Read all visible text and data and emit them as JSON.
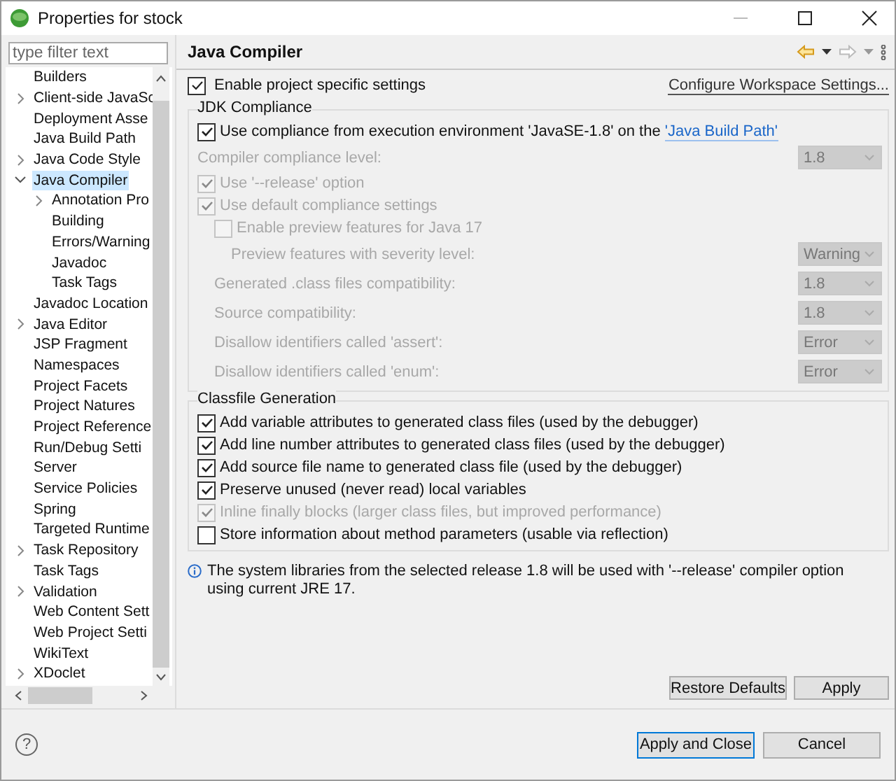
{
  "window": {
    "title": "Properties for stock"
  },
  "sidebar": {
    "filter": {
      "placeholder": "type filter text"
    },
    "items": [
      {
        "label": "Builders",
        "selected": false
      },
      {
        "label": "Client-side JavaSc",
        "selected": false,
        "expanded": false
      },
      {
        "label": "Deployment Asse",
        "selected": false
      },
      {
        "label": "Java Build Path",
        "selected": false
      },
      {
        "label": "Java Code Style",
        "selected": false,
        "expanded": false
      },
      {
        "label": "Java Compiler",
        "selected": true,
        "expanded": true,
        "children": [
          {
            "label": "Annotation Pro",
            "selected": false,
            "expanded": false
          },
          {
            "label": "Building",
            "selected": false
          },
          {
            "label": "Errors/Warning",
            "selected": false
          },
          {
            "label": "Javadoc",
            "selected": false
          },
          {
            "label": "Task Tags",
            "selected": false
          }
        ]
      },
      {
        "label": "Javadoc Location",
        "selected": false
      },
      {
        "label": "Java Editor",
        "selected": false,
        "expanded": false
      },
      {
        "label": "JSP Fragment",
        "selected": false
      },
      {
        "label": "Namespaces",
        "selected": false
      },
      {
        "label": "Project Facets",
        "selected": false
      },
      {
        "label": "Project Natures",
        "selected": false
      },
      {
        "label": "Project Reference",
        "selected": false
      },
      {
        "label": "Run/Debug Setti",
        "selected": false
      },
      {
        "label": "Server",
        "selected": false
      },
      {
        "label": "Service Policies",
        "selected": false
      },
      {
        "label": "Spring",
        "selected": false
      },
      {
        "label": "Targeted Runtime",
        "selected": false
      },
      {
        "label": "Task Repository",
        "selected": false,
        "expanded": false
      },
      {
        "label": "Task Tags",
        "selected": false
      },
      {
        "label": "Validation",
        "selected": false,
        "expanded": false
      },
      {
        "label": "Web Content Sett",
        "selected": false
      },
      {
        "label": "Web Project Setti",
        "selected": false
      },
      {
        "label": "WikiText",
        "selected": false
      },
      {
        "label": "XDoclet",
        "selected": false,
        "expanded": false
      }
    ]
  },
  "page": {
    "title": "Java Compiler",
    "enable_project_settings": {
      "label": "Enable project specific settings",
      "checked": true
    },
    "configure_link": "Configure Workspace Settings...",
    "jdk_compliance": {
      "title": "JDK Compliance",
      "rows": [
        {
          "kind": "checkbox",
          "label": "Use compliance from execution environment 'JavaSE-1.8' on the ",
          "link": "'Java Build Path'",
          "checked": true,
          "disabled": false
        },
        {
          "kind": "combo",
          "label": "Compiler compliance level:",
          "value": "1.8",
          "disabled": true
        },
        {
          "kind": "checkbox",
          "label": "Use '--release' option",
          "checked": true,
          "disabled": true
        },
        {
          "kind": "checkbox",
          "label": "Use default compliance settings",
          "checked": true,
          "disabled": true,
          "children": [
            {
              "kind": "checkbox",
              "label": "Enable preview features for Java 17",
              "checked": false,
              "disabled": true,
              "children": [
                {
                  "kind": "combo",
                  "label": "Preview features with severity level:",
                  "value": "Warning",
                  "disabled": true
                }
              ]
            },
            {
              "kind": "combo",
              "label": "Generated .class files compatibility:",
              "value": "1.8",
              "disabled": true
            },
            {
              "kind": "combo",
              "label": "Source compatibility:",
              "value": "1.8",
              "disabled": true
            },
            {
              "kind": "combo",
              "label": "Disallow identifiers called 'assert':",
              "value": "Error",
              "disabled": true
            },
            {
              "kind": "combo",
              "label": "Disallow identifiers called 'enum':",
              "value": "Error",
              "disabled": true
            }
          ]
        }
      ]
    },
    "classfile_generation": {
      "title": "Classfile Generation",
      "rows": [
        {
          "kind": "checkbox",
          "label": "Add variable attributes to generated class files (used by the debugger)",
          "checked": true,
          "disabled": false
        },
        {
          "kind": "checkbox",
          "label": "Add line number attributes to generated class files (used by the debugger)",
          "checked": true,
          "disabled": false
        },
        {
          "kind": "checkbox",
          "label": "Add source file name to generated class file (used by the debugger)",
          "checked": true,
          "disabled": false
        },
        {
          "kind": "checkbox",
          "label": "Preserve unused (never read) local variables",
          "checked": true,
          "disabled": false
        },
        {
          "kind": "checkbox",
          "label": "Inline finally blocks (larger class files, but improved performance)",
          "checked": true,
          "disabled": true
        },
        {
          "kind": "checkbox",
          "label": "Store information about method parameters (usable via reflection)",
          "checked": false,
          "disabled": false
        }
      ]
    },
    "info": "The system libraries from the selected release 1.8 will be used with '--release' compiler option using current JRE 17.",
    "page_buttons": [
      "Restore Defaults",
      "Apply"
    ]
  },
  "footer": {
    "help": "?",
    "buttons": [
      {
        "label": "Apply and Close",
        "default": true
      },
      {
        "label": "Cancel",
        "default": false
      }
    ]
  }
}
